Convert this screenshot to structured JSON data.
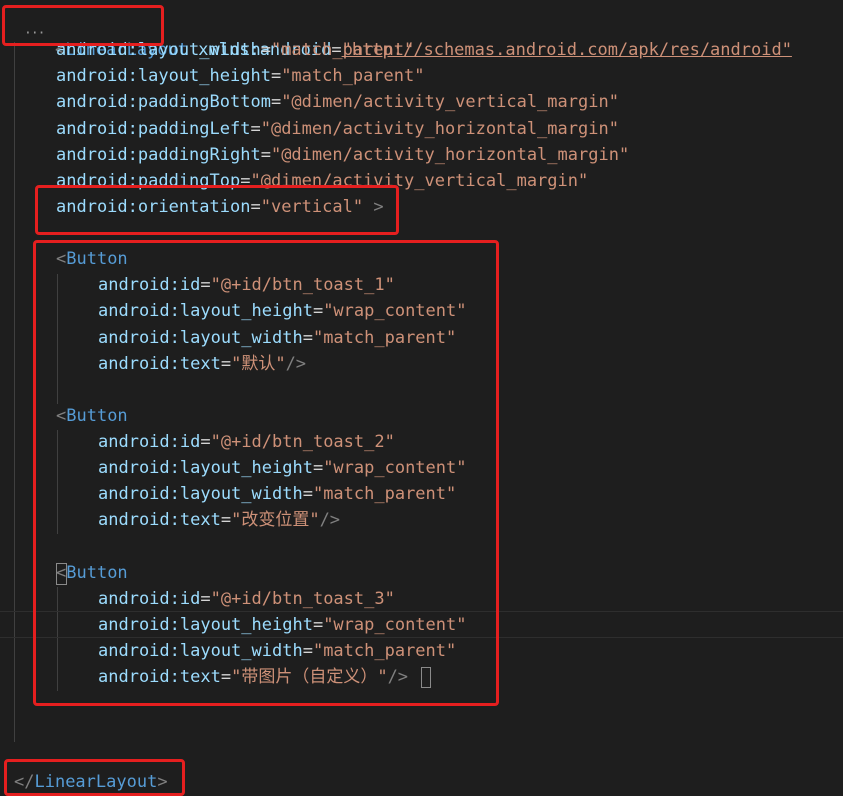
{
  "editor": {
    "root_open_tag": "LinearLayout",
    "xmlns_attr": "xmlns:android",
    "xmlns_value": "\"http://schemas.android.com/apk/res/android\"",
    "root_attrs": [
      {
        "name": "android:layout_width",
        "value": "\"match_parent\""
      },
      {
        "name": "android:layout_height",
        "value": "\"match_parent\""
      },
      {
        "name": "android:paddingBottom",
        "value": "\"@dimen/activity_vertical_margin\""
      },
      {
        "name": "android:paddingLeft",
        "value": "\"@dimen/activity_horizontal_margin\""
      },
      {
        "name": "android:paddingRight",
        "value": "\"@dimen/activity_horizontal_margin\""
      },
      {
        "name": "android:paddingTop",
        "value": "\"@dimen/activity_vertical_margin\""
      },
      {
        "name": "android:orientation",
        "value": "\"vertical\""
      }
    ],
    "buttons": [
      {
        "tag": "Button",
        "id": "\"@+id/btn_toast_1\"",
        "layout_height": "\"wrap_content\"",
        "layout_width": "\"match_parent\"",
        "text": "\"默认\""
      },
      {
        "tag": "Button",
        "id": "\"@+id/btn_toast_2\"",
        "layout_height": "\"wrap_content\"",
        "layout_width": "\"match_parent\"",
        "text": "\"改变位置\""
      },
      {
        "tag": "Button",
        "id": "\"@+id/btn_toast_3\"",
        "layout_height": "\"wrap_content\"",
        "layout_width": "\"match_parent\"",
        "text": "\"带图片（自定义）\""
      }
    ],
    "attr_names": {
      "id": "android:id",
      "layout_height": "android:layout_height",
      "layout_width": "android:layout_width",
      "text": "android:text"
    },
    "root_close_tag": "LinearLayout",
    "punct": {
      "lt": "<",
      "gt": ">",
      "close_lt": "</",
      "self_close": "/>",
      "eq": "="
    },
    "colors": {
      "background": "#1e1e1e",
      "tag": "#569cd6",
      "attribute": "#9cdcfe",
      "string": "#ce9178",
      "highlight_box": "#e51f1f"
    }
  }
}
